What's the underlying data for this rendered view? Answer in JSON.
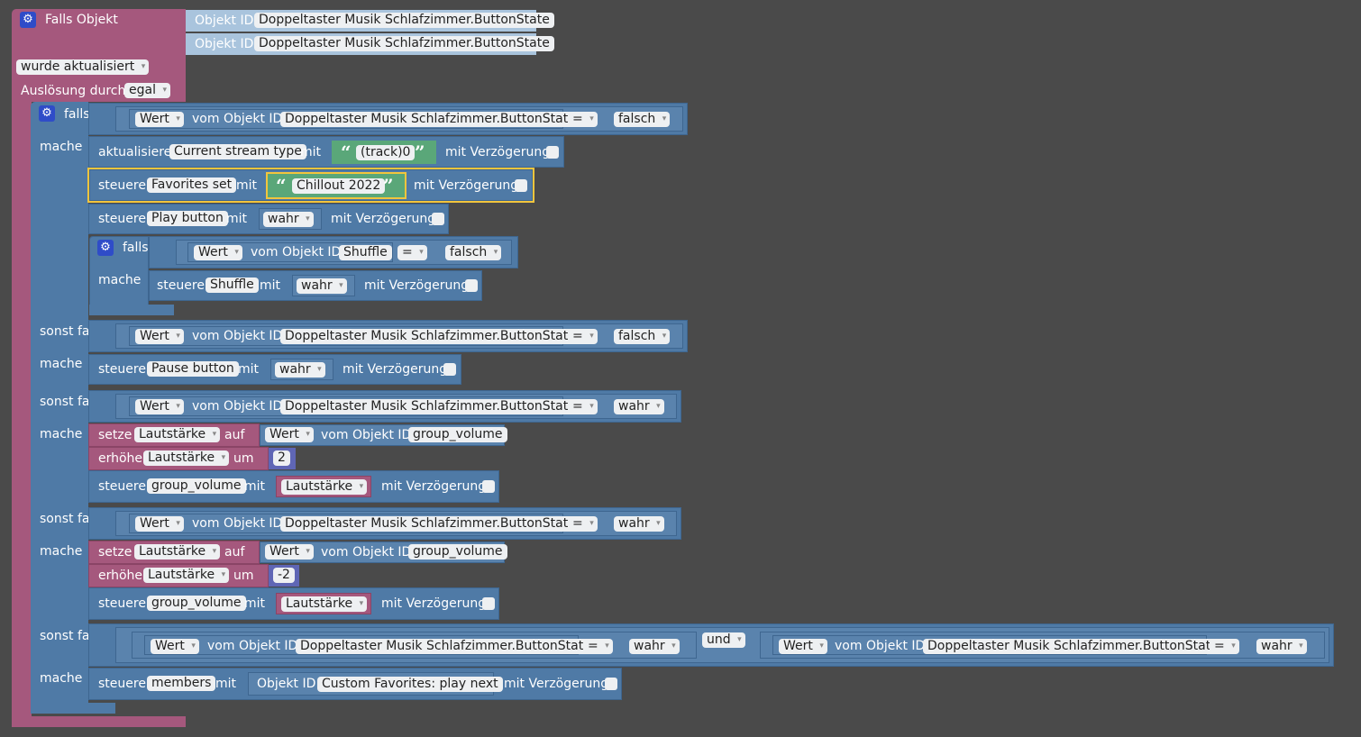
{
  "trigger": {
    "title": "Falls Objekt",
    "object_id_label": "Objekt ID",
    "object_ids": [
      "Doppeltaster Musik Schlafzimmer.ButtonState",
      "Doppeltaster Musik Schlafzimmer.ButtonState"
    ],
    "event_option": "wurde aktualisiert",
    "trigger_label": "Auslösung durch",
    "trigger_option": "egal"
  },
  "words": {
    "falls": "falls",
    "mache": "mache",
    "sonst_falls": "sonst falls",
    "wert": "Wert",
    "vom_objekt_id": "vom Objekt ID",
    "eq": "=",
    "falsch": "falsch",
    "wahr": "wahr",
    "aktualisiere": "aktualisiere",
    "steuere": "steuere",
    "mit": "mit",
    "mit_verzoegerung": "mit Verzögerung",
    "setze": "setze",
    "auf": "auf",
    "erhoehe": "erhöhe",
    "um": "um",
    "und": "und",
    "objekt_id": "Objekt ID",
    "button_state": "Doppeltaster Musik Schlafzimmer.ButtonState"
  },
  "states": {
    "current_stream_type": "Current stream type",
    "track_text": "(track)0",
    "favorites_set": "Favorites set",
    "chillout_text": "Chillout 2022",
    "play_button": "Play button",
    "shuffle": "Shuffle",
    "pause_button": "Pause button",
    "group_volume": "group_volume",
    "members": "members",
    "custom_play_next": "Custom Favorites: play next"
  },
  "variables": {
    "lautstaerke": "Lautstärke"
  },
  "numbers": {
    "inc_up": "2",
    "inc_down": "-2"
  },
  "colors": {
    "event_block": "#a5587d",
    "logic_block": "#4f7aa6",
    "text_block": "#5aa779",
    "number_block": "#5f66b5",
    "selected_outline": "#f2c53d",
    "workspace": "#4a4a4a"
  }
}
